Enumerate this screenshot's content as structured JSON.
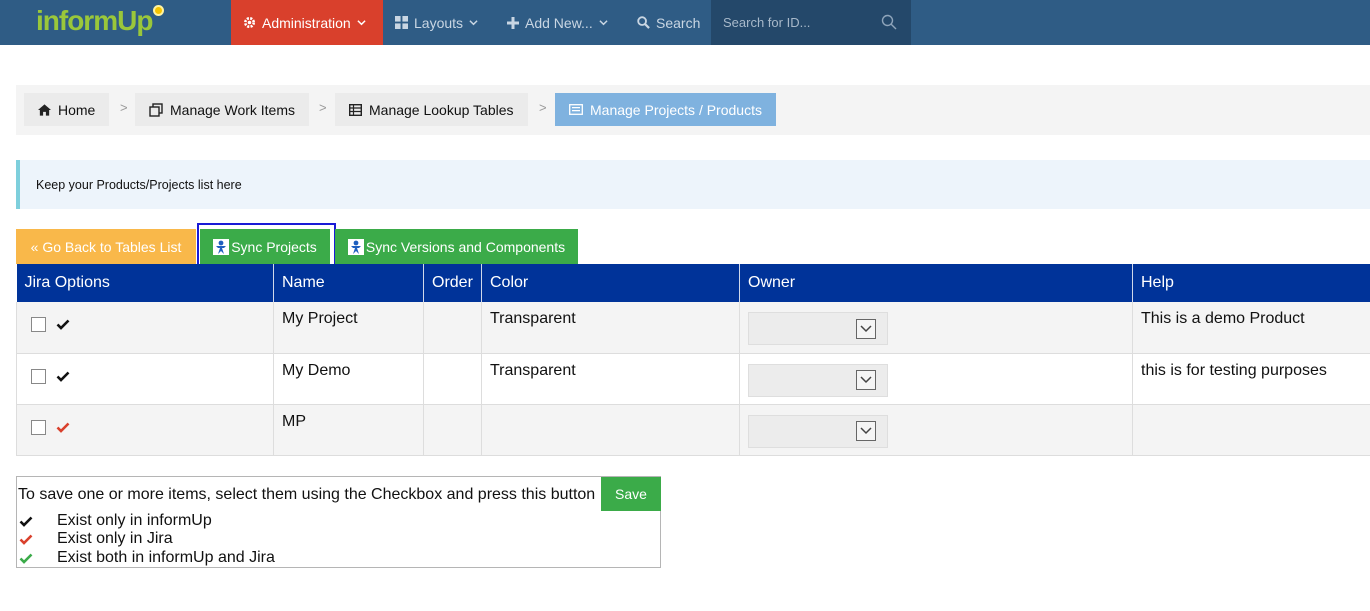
{
  "nav": {
    "logo": "informUp",
    "items": [
      {
        "label": "Administration",
        "icon": "gear-icon",
        "active": true
      },
      {
        "label": "Layouts",
        "icon": "grid-icon"
      },
      {
        "label": "Add New...",
        "icon": "plus-icon"
      },
      {
        "label": "Search",
        "icon": "search-icon"
      }
    ],
    "search_placeholder": "Search for ID..."
  },
  "breadcrumb": [
    {
      "label": "Home",
      "icon": "home-icon"
    },
    {
      "label": "Manage Work Items",
      "icon": "copy-icon"
    },
    {
      "label": "Manage Lookup Tables",
      "icon": "table-icon"
    },
    {
      "label": "Manage Projects / Products",
      "icon": "list-icon"
    }
  ],
  "info": "Keep your Products/Projects list here",
  "actions": {
    "back": "« Go Back to Tables List",
    "sync_projects": "Sync Projects",
    "sync_versions": "Sync Versions and Components"
  },
  "table": {
    "headers": [
      "Jira Options",
      "Name",
      "Order",
      "Color",
      "Owner",
      "Help"
    ],
    "rows": [
      {
        "check_color": "#111111",
        "name": "My Project",
        "order": "",
        "color": "Transparent",
        "owner": "",
        "help": "This is a demo Product"
      },
      {
        "check_color": "#111111",
        "name": "My Demo",
        "order": "",
        "color": "Transparent",
        "owner": "",
        "help": "this is for testing purposes"
      },
      {
        "check_color": "#d9402c",
        "name": "MP",
        "order": "",
        "color": "",
        "owner": "",
        "help": ""
      }
    ]
  },
  "legend": {
    "instruction": "To save one or more items, select them using the Checkbox and press this button",
    "save": "Save",
    "items": [
      {
        "label": "Exist only in informUp",
        "color": "#111111"
      },
      {
        "label": "Exist only in Jira",
        "color": "#d9402c"
      },
      {
        "label": "Exist both in informUp and Jira",
        "color": "#3bab49"
      }
    ]
  },
  "colors": {
    "nav_bg": "#2f5c85",
    "active_nav": "#d9402c",
    "table_header": "#003399",
    "green": "#3bab49",
    "orange": "#f9b84a",
    "breadcrumb_current": "#7fb2df"
  }
}
